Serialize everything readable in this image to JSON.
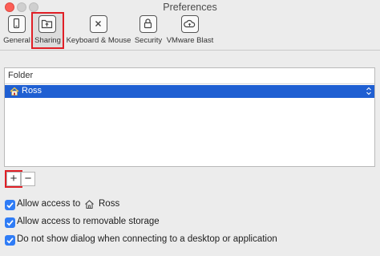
{
  "window": {
    "title": "Preferences"
  },
  "toolbar": {
    "items": [
      {
        "label": "General",
        "icon": "phone-icon"
      },
      {
        "label": "Sharing",
        "icon": "shared-folder-icon",
        "selected": true
      },
      {
        "label": "Keyboard & Mouse",
        "icon": "keyboard-icon"
      },
      {
        "label": "Security",
        "icon": "lock-icon"
      },
      {
        "label": "VMware Blast",
        "icon": "cloud-icon"
      }
    ]
  },
  "folders": {
    "header": "Folder",
    "rows": [
      {
        "label": "Ross",
        "icon": "home-icon",
        "selected": true
      }
    ]
  },
  "buttons": {
    "add_label": "+",
    "remove_label": "−"
  },
  "options": {
    "allow_access_prefix": "Allow access to",
    "allow_access_target": "Ross",
    "allow_access_checked": true,
    "removable_storage_label": "Allow access to removable storage",
    "removable_storage_checked": true,
    "no_dialog_label": "Do not show dialog when connecting to a desktop or application",
    "no_dialog_checked": true
  },
  "colors": {
    "selection": "#1f5fd2",
    "highlight_outline": "#e01f26",
    "checkbox": "#2f7cf6"
  }
}
